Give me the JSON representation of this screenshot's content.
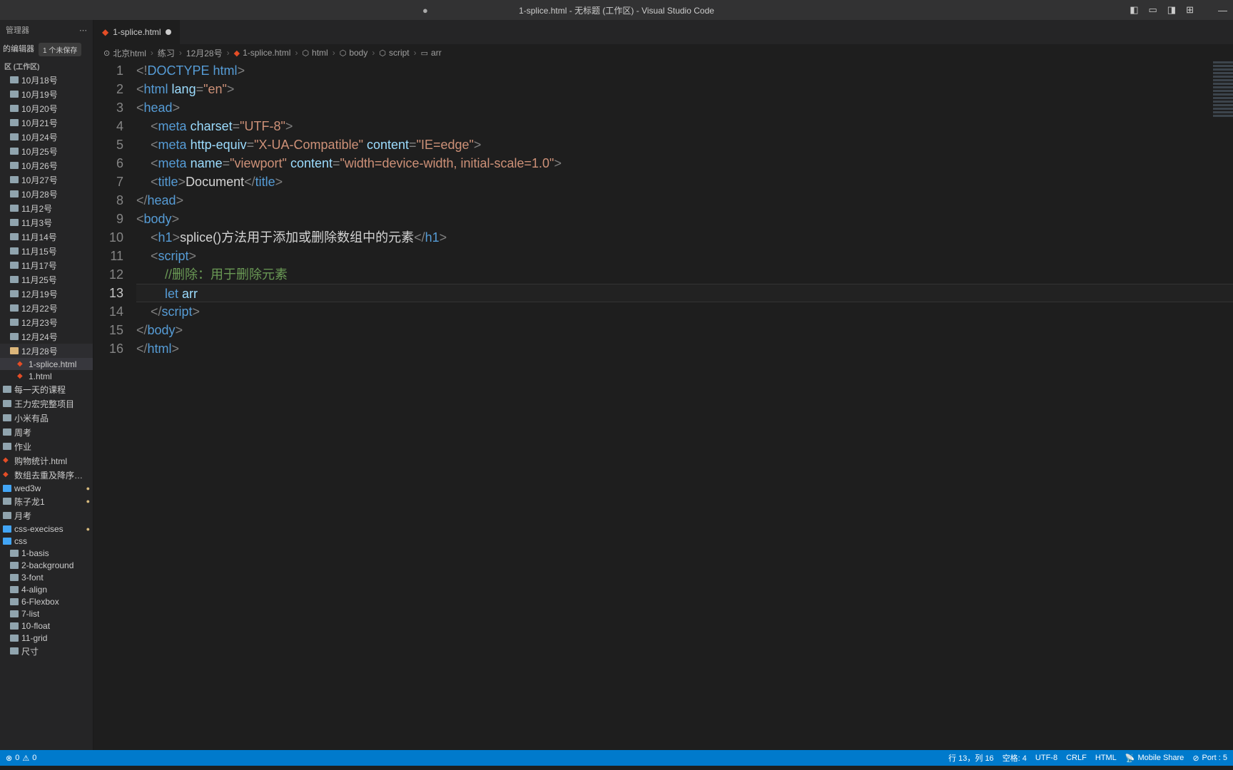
{
  "titlebar": {
    "title": "1-splice.html - 无标题 (工作区) - Visual Studio Code",
    "modified_indicator": "●"
  },
  "sidebar": {
    "section_label": "管理器",
    "open_editors_label": "的编辑器",
    "unsaved_badge": "1 个未保存",
    "workspace_label": "区 (工作区)",
    "items": [
      {
        "type": "folder",
        "label": "10月18号",
        "indent": 1
      },
      {
        "type": "folder",
        "label": "10月19号",
        "indent": 1
      },
      {
        "type": "folder",
        "label": "10月20号",
        "indent": 1
      },
      {
        "type": "folder",
        "label": "10月21号",
        "indent": 1
      },
      {
        "type": "folder",
        "label": "10月24号",
        "indent": 1
      },
      {
        "type": "folder",
        "label": "10月25号",
        "indent": 1
      },
      {
        "type": "folder",
        "label": "10月26号",
        "indent": 1
      },
      {
        "type": "folder",
        "label": "10月27号",
        "indent": 1
      },
      {
        "type": "folder",
        "label": "10月28号",
        "indent": 1
      },
      {
        "type": "folder",
        "label": "11月2号",
        "indent": 1
      },
      {
        "type": "folder",
        "label": "11月3号",
        "indent": 1
      },
      {
        "type": "folder",
        "label": "11月14号",
        "indent": 1
      },
      {
        "type": "folder",
        "label": "11月15号",
        "indent": 1
      },
      {
        "type": "folder",
        "label": "11月17号",
        "indent": 1
      },
      {
        "type": "folder",
        "label": "11月25号",
        "indent": 1
      },
      {
        "type": "folder",
        "label": "12月19号",
        "indent": 1
      },
      {
        "type": "folder",
        "label": "12月22号",
        "indent": 1
      },
      {
        "type": "folder",
        "label": "12月23号",
        "indent": 1
      },
      {
        "type": "folder",
        "label": "12月24号",
        "indent": 1
      },
      {
        "type": "folder-open",
        "label": "12月28号",
        "indent": 1,
        "expanded": true
      },
      {
        "type": "file-html",
        "label": "1-splice.html",
        "indent": 2,
        "active": true
      },
      {
        "type": "file-html",
        "label": "1.html",
        "indent": 2
      },
      {
        "type": "folder",
        "label": "每一天的课程",
        "indent": 0
      },
      {
        "type": "folder",
        "label": "王力宏完整项目",
        "indent": 0
      },
      {
        "type": "folder",
        "label": "小米有品",
        "indent": 0
      },
      {
        "type": "folder",
        "label": "周考",
        "indent": 0
      },
      {
        "type": "folder",
        "label": "作业",
        "indent": 0
      },
      {
        "type": "file-html",
        "label": "购物统计.html",
        "indent": 0
      },
      {
        "type": "file-html",
        "label": "数组去重及降序排序.html",
        "indent": 0
      },
      {
        "type": "folder-blue",
        "label": "wed3w",
        "indent": 0,
        "git": "●"
      },
      {
        "type": "folder",
        "label": "陈子龙1",
        "indent": 0,
        "git": "●"
      },
      {
        "type": "folder",
        "label": "月考",
        "indent": 0
      },
      {
        "type": "folder-blue",
        "label": "css-execises",
        "indent": 0,
        "git": "●"
      },
      {
        "type": "folder-blue",
        "label": "css",
        "indent": 0,
        "git": ""
      },
      {
        "type": "folder",
        "label": "1-basis",
        "indent": 1
      },
      {
        "type": "folder",
        "label": "2-background",
        "indent": 1
      },
      {
        "type": "folder",
        "label": "3-font",
        "indent": 1
      },
      {
        "type": "folder",
        "label": "4-align",
        "indent": 1
      },
      {
        "type": "folder",
        "label": "6-Flexbox",
        "indent": 1
      },
      {
        "type": "folder",
        "label": "7-list",
        "indent": 1
      },
      {
        "type": "folder",
        "label": "10-float",
        "indent": 1
      },
      {
        "type": "folder",
        "label": "11-grid",
        "indent": 1
      },
      {
        "type": "folder",
        "label": "尺寸",
        "indent": 1
      }
    ]
  },
  "tab": {
    "filename": "1-splice.html"
  },
  "breadcrumb": {
    "parts": [
      "北京html",
      "练习",
      "12月28号",
      "1-splice.html",
      "html",
      "body",
      "script",
      "arr"
    ]
  },
  "code": {
    "current_line": 13,
    "lines": [
      {
        "n": 1,
        "tokens": [
          [
            "bracket",
            "<!"
          ],
          [
            "doctype",
            "DOCTYPE"
          ],
          [
            "text",
            " "
          ],
          [
            "tag",
            "html"
          ],
          [
            "bracket",
            ">"
          ]
        ]
      },
      {
        "n": 2,
        "tokens": [
          [
            "bracket",
            "<"
          ],
          [
            "tag",
            "html"
          ],
          [
            "text",
            " "
          ],
          [
            "attr",
            "lang"
          ],
          [
            "bracket",
            "="
          ],
          [
            "string",
            "\"en\""
          ],
          [
            "bracket",
            ">"
          ]
        ]
      },
      {
        "n": 3,
        "tokens": [
          [
            "bracket",
            "<"
          ],
          [
            "tag",
            "head"
          ],
          [
            "bracket",
            ">"
          ]
        ]
      },
      {
        "n": 4,
        "tokens": [
          [
            "text",
            "    "
          ],
          [
            "bracket",
            "<"
          ],
          [
            "tag",
            "meta"
          ],
          [
            "text",
            " "
          ],
          [
            "attr",
            "charset"
          ],
          [
            "bracket",
            "="
          ],
          [
            "string",
            "\"UTF-8\""
          ],
          [
            "bracket",
            ">"
          ]
        ]
      },
      {
        "n": 5,
        "tokens": [
          [
            "text",
            "    "
          ],
          [
            "bracket",
            "<"
          ],
          [
            "tag",
            "meta"
          ],
          [
            "text",
            " "
          ],
          [
            "attr",
            "http-equiv"
          ],
          [
            "bracket",
            "="
          ],
          [
            "string",
            "\"X-UA-Compatible\""
          ],
          [
            "text",
            " "
          ],
          [
            "attr",
            "content"
          ],
          [
            "bracket",
            "="
          ],
          [
            "string",
            "\"IE=edge\""
          ],
          [
            "bracket",
            ">"
          ]
        ]
      },
      {
        "n": 6,
        "tokens": [
          [
            "text",
            "    "
          ],
          [
            "bracket",
            "<"
          ],
          [
            "tag",
            "meta"
          ],
          [
            "text",
            " "
          ],
          [
            "attr",
            "name"
          ],
          [
            "bracket",
            "="
          ],
          [
            "string",
            "\"viewport\""
          ],
          [
            "text",
            " "
          ],
          [
            "attr",
            "content"
          ],
          [
            "bracket",
            "="
          ],
          [
            "string",
            "\"width=device-width, initial-scale=1.0\""
          ],
          [
            "bracket",
            ">"
          ]
        ]
      },
      {
        "n": 7,
        "tokens": [
          [
            "text",
            "    "
          ],
          [
            "bracket",
            "<"
          ],
          [
            "tag",
            "title"
          ],
          [
            "bracket",
            ">"
          ],
          [
            "text",
            "Document"
          ],
          [
            "bracket",
            "</"
          ],
          [
            "tag",
            "title"
          ],
          [
            "bracket",
            ">"
          ]
        ]
      },
      {
        "n": 8,
        "tokens": [
          [
            "bracket",
            "</"
          ],
          [
            "tag",
            "head"
          ],
          [
            "bracket",
            ">"
          ]
        ]
      },
      {
        "n": 9,
        "tokens": [
          [
            "bracket",
            "<"
          ],
          [
            "tag",
            "body"
          ],
          [
            "bracket",
            ">"
          ]
        ]
      },
      {
        "n": 10,
        "tokens": [
          [
            "text",
            "    "
          ],
          [
            "bracket",
            "<"
          ],
          [
            "tag",
            "h1"
          ],
          [
            "bracket",
            ">"
          ],
          [
            "text",
            "splice()方法用于添加或删除数组中的元素"
          ],
          [
            "bracket",
            "</"
          ],
          [
            "tag",
            "h1"
          ],
          [
            "bracket",
            ">"
          ]
        ]
      },
      {
        "n": 11,
        "tokens": [
          [
            "text",
            "    "
          ],
          [
            "bracket",
            "<"
          ],
          [
            "tag",
            "script"
          ],
          [
            "bracket",
            ">"
          ]
        ]
      },
      {
        "n": 12,
        "tokens": [
          [
            "text",
            "        "
          ],
          [
            "comment",
            "//删除：用于删除元素"
          ]
        ]
      },
      {
        "n": 13,
        "tokens": [
          [
            "text",
            "        "
          ],
          [
            "keyword",
            "let"
          ],
          [
            "text",
            " "
          ],
          [
            "var",
            "arr"
          ]
        ]
      },
      {
        "n": 14,
        "tokens": [
          [
            "text",
            "    "
          ],
          [
            "bracket",
            "</"
          ],
          [
            "tag",
            "script"
          ],
          [
            "bracket",
            ">"
          ]
        ]
      },
      {
        "n": 15,
        "tokens": [
          [
            "bracket",
            "</"
          ],
          [
            "tag",
            "body"
          ],
          [
            "bracket",
            ">"
          ]
        ]
      },
      {
        "n": 16,
        "tokens": [
          [
            "bracket",
            "</"
          ],
          [
            "tag",
            "html"
          ],
          [
            "bracket",
            ">"
          ]
        ]
      }
    ]
  },
  "statusbar": {
    "errors": "0",
    "warnings": "0",
    "line_col": "行 13，列 16",
    "spaces": "空格: 4",
    "encoding": "UTF-8",
    "eol": "CRLF",
    "lang": "HTML",
    "mobile": "Mobile Share",
    "port": "Port : 5"
  }
}
